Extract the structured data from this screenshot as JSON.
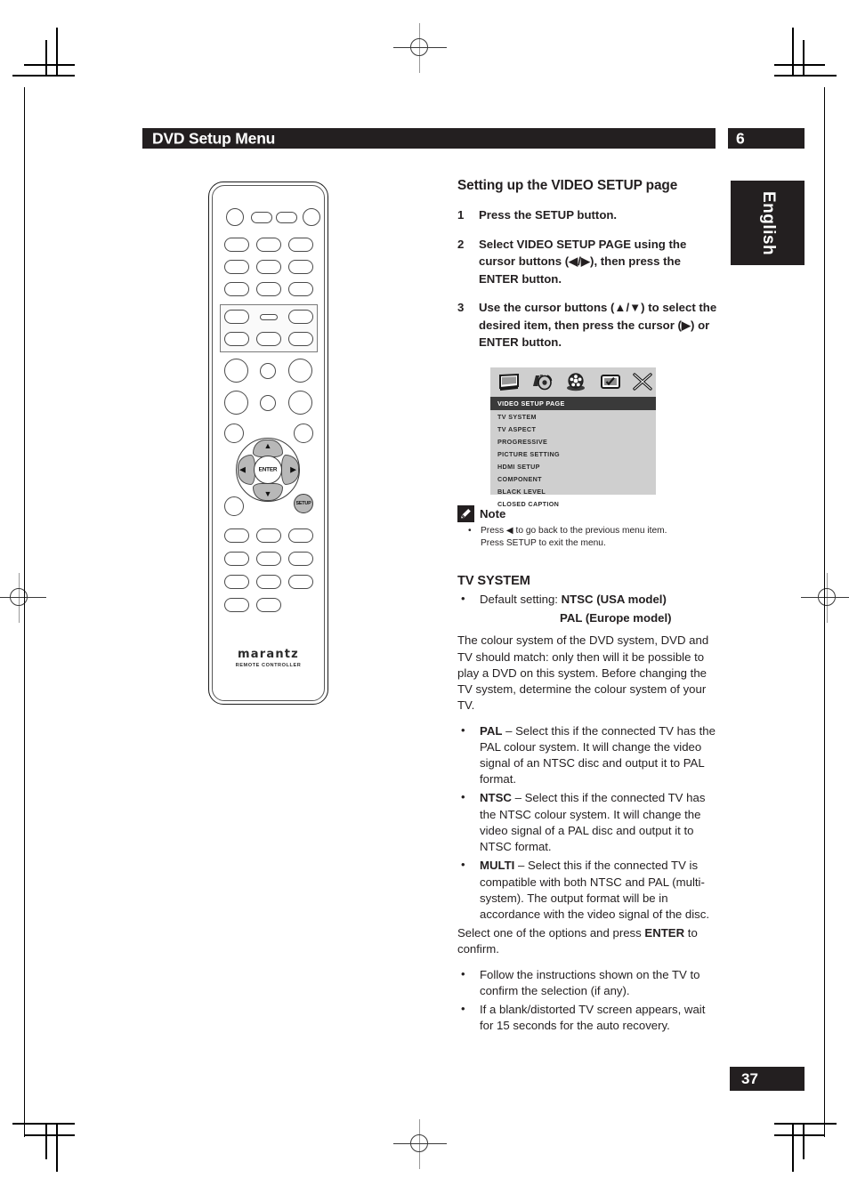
{
  "header": {
    "title": "DVD Setup Menu",
    "chapter": "6",
    "language_tab": "English",
    "page_number": "37"
  },
  "remote": {
    "brand": "marantz",
    "subtitle": "REMOTE CONTROLLER",
    "enter_label": "ENTER",
    "setup_label": "SETUP",
    "arrow_up": "▲",
    "arrow_down": "▼",
    "arrow_left": "◀",
    "arrow_right": "▶"
  },
  "section": {
    "title": "Setting up the VIDEO SETUP page",
    "steps": [
      {
        "n": "1",
        "text": "Press the SETUP button."
      },
      {
        "n": "2",
        "text": "Select VIDEO SETUP PAGE using the cursor buttons (◀/▶), then press the ENTER button."
      },
      {
        "n": "3",
        "text": "Use the cursor buttons (▲/▼) to select the desired item, then press the cursor (▶) or ENTER button."
      }
    ]
  },
  "osd": {
    "title": "VIDEO SETUP PAGE",
    "icons": [
      "video-display-icon",
      "audio-speaker-icon",
      "disc-film-icon",
      "preference-screen-icon",
      "exit-close-icon"
    ],
    "items": [
      "TV SYSTEM",
      "TV ASPECT",
      "PROGRESSIVE",
      "PICTURE SETTING",
      "HDMI SETUP",
      "COMPONENT",
      "BLACK LEVEL",
      "CLOSED CAPTION"
    ],
    "colors": {
      "panel_bg": "#cfcfcf",
      "title_bg": "#3a3a3a",
      "title_fg": "#ffffff"
    }
  },
  "note": {
    "label": "Note",
    "bullet": "•",
    "line1": "Press ◀ to go back to the previous menu item.",
    "line2": "Press SETUP to exit the menu."
  },
  "tv_system": {
    "title": "TV SYSTEM",
    "default_bullet": "•",
    "default_label": "Default setting:",
    "default_value_1": "NTSC (USA model)",
    "default_value_2": "PAL (Europe model)",
    "intro": "The colour system of the DVD system, DVD and TV should match: only then will it be possible to play a DVD on this system. Before changing the TV system, determine the colour system of your TV.",
    "options": [
      {
        "name": "PAL",
        "dash": "–",
        "desc": "Select this if the connected TV has the PAL colour system. It will change the video signal of an NTSC disc and output it to PAL format."
      },
      {
        "name": "NTSC",
        "dash": "–",
        "desc": "Select this if the connected TV has the NTSC colour system. It will change the video signal of a PAL disc and output it to NTSC format."
      },
      {
        "name": "MULTI",
        "dash": "–",
        "desc": "Select this if the connected TV is compatible with both NTSC and PAL (multi-system). The output format will be in accordance with the video signal of the disc."
      }
    ],
    "confirm_pre": "Select one of the options and press ",
    "confirm_bold": "ENTER",
    "confirm_post": " to confirm.",
    "closing_bullets": [
      "Follow the instructions shown on the TV to confirm the selection (if any).",
      "If a blank/distorted TV screen appears, wait for 15 seconds for the auto recovery."
    ]
  }
}
